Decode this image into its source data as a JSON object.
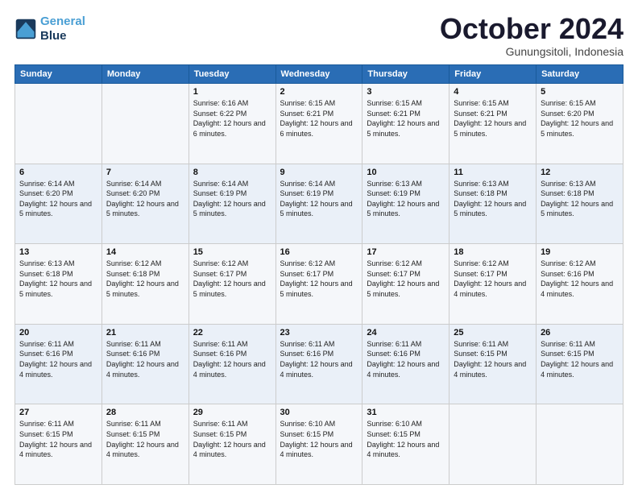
{
  "header": {
    "logo_line1": "General",
    "logo_line2": "Blue",
    "month": "October 2024",
    "location": "Gunungsitoli, Indonesia"
  },
  "days_of_week": [
    "Sunday",
    "Monday",
    "Tuesday",
    "Wednesday",
    "Thursday",
    "Friday",
    "Saturday"
  ],
  "weeks": [
    [
      {
        "day": "",
        "info": ""
      },
      {
        "day": "",
        "info": ""
      },
      {
        "day": "1",
        "info": "Sunrise: 6:16 AM\nSunset: 6:22 PM\nDaylight: 12 hours and 6 minutes."
      },
      {
        "day": "2",
        "info": "Sunrise: 6:15 AM\nSunset: 6:21 PM\nDaylight: 12 hours and 6 minutes."
      },
      {
        "day": "3",
        "info": "Sunrise: 6:15 AM\nSunset: 6:21 PM\nDaylight: 12 hours and 5 minutes."
      },
      {
        "day": "4",
        "info": "Sunrise: 6:15 AM\nSunset: 6:21 PM\nDaylight: 12 hours and 5 minutes."
      },
      {
        "day": "5",
        "info": "Sunrise: 6:15 AM\nSunset: 6:20 PM\nDaylight: 12 hours and 5 minutes."
      }
    ],
    [
      {
        "day": "6",
        "info": "Sunrise: 6:14 AM\nSunset: 6:20 PM\nDaylight: 12 hours and 5 minutes."
      },
      {
        "day": "7",
        "info": "Sunrise: 6:14 AM\nSunset: 6:20 PM\nDaylight: 12 hours and 5 minutes."
      },
      {
        "day": "8",
        "info": "Sunrise: 6:14 AM\nSunset: 6:19 PM\nDaylight: 12 hours and 5 minutes."
      },
      {
        "day": "9",
        "info": "Sunrise: 6:14 AM\nSunset: 6:19 PM\nDaylight: 12 hours and 5 minutes."
      },
      {
        "day": "10",
        "info": "Sunrise: 6:13 AM\nSunset: 6:19 PM\nDaylight: 12 hours and 5 minutes."
      },
      {
        "day": "11",
        "info": "Sunrise: 6:13 AM\nSunset: 6:18 PM\nDaylight: 12 hours and 5 minutes."
      },
      {
        "day": "12",
        "info": "Sunrise: 6:13 AM\nSunset: 6:18 PM\nDaylight: 12 hours and 5 minutes."
      }
    ],
    [
      {
        "day": "13",
        "info": "Sunrise: 6:13 AM\nSunset: 6:18 PM\nDaylight: 12 hours and 5 minutes."
      },
      {
        "day": "14",
        "info": "Sunrise: 6:12 AM\nSunset: 6:18 PM\nDaylight: 12 hours and 5 minutes."
      },
      {
        "day": "15",
        "info": "Sunrise: 6:12 AM\nSunset: 6:17 PM\nDaylight: 12 hours and 5 minutes."
      },
      {
        "day": "16",
        "info": "Sunrise: 6:12 AM\nSunset: 6:17 PM\nDaylight: 12 hours and 5 minutes."
      },
      {
        "day": "17",
        "info": "Sunrise: 6:12 AM\nSunset: 6:17 PM\nDaylight: 12 hours and 5 minutes."
      },
      {
        "day": "18",
        "info": "Sunrise: 6:12 AM\nSunset: 6:17 PM\nDaylight: 12 hours and 4 minutes."
      },
      {
        "day": "19",
        "info": "Sunrise: 6:12 AM\nSunset: 6:16 PM\nDaylight: 12 hours and 4 minutes."
      }
    ],
    [
      {
        "day": "20",
        "info": "Sunrise: 6:11 AM\nSunset: 6:16 PM\nDaylight: 12 hours and 4 minutes."
      },
      {
        "day": "21",
        "info": "Sunrise: 6:11 AM\nSunset: 6:16 PM\nDaylight: 12 hours and 4 minutes."
      },
      {
        "day": "22",
        "info": "Sunrise: 6:11 AM\nSunset: 6:16 PM\nDaylight: 12 hours and 4 minutes."
      },
      {
        "day": "23",
        "info": "Sunrise: 6:11 AM\nSunset: 6:16 PM\nDaylight: 12 hours and 4 minutes."
      },
      {
        "day": "24",
        "info": "Sunrise: 6:11 AM\nSunset: 6:16 PM\nDaylight: 12 hours and 4 minutes."
      },
      {
        "day": "25",
        "info": "Sunrise: 6:11 AM\nSunset: 6:15 PM\nDaylight: 12 hours and 4 minutes."
      },
      {
        "day": "26",
        "info": "Sunrise: 6:11 AM\nSunset: 6:15 PM\nDaylight: 12 hours and 4 minutes."
      }
    ],
    [
      {
        "day": "27",
        "info": "Sunrise: 6:11 AM\nSunset: 6:15 PM\nDaylight: 12 hours and 4 minutes."
      },
      {
        "day": "28",
        "info": "Sunrise: 6:11 AM\nSunset: 6:15 PM\nDaylight: 12 hours and 4 minutes."
      },
      {
        "day": "29",
        "info": "Sunrise: 6:11 AM\nSunset: 6:15 PM\nDaylight: 12 hours and 4 minutes."
      },
      {
        "day": "30",
        "info": "Sunrise: 6:10 AM\nSunset: 6:15 PM\nDaylight: 12 hours and 4 minutes."
      },
      {
        "day": "31",
        "info": "Sunrise: 6:10 AM\nSunset: 6:15 PM\nDaylight: 12 hours and 4 minutes."
      },
      {
        "day": "",
        "info": ""
      },
      {
        "day": "",
        "info": ""
      }
    ]
  ]
}
